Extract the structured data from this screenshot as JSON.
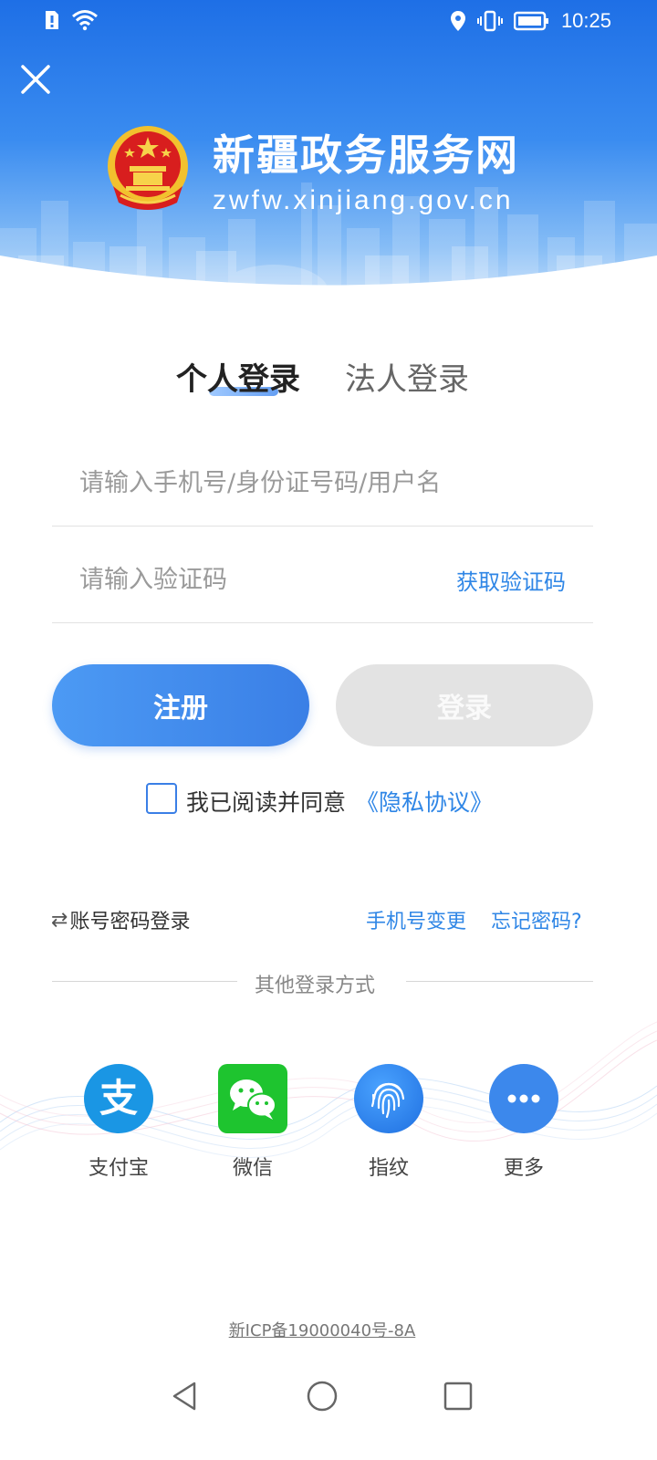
{
  "status_bar": {
    "time": "10:25",
    "icons": [
      "sim-alert-icon",
      "wifi-icon",
      "location-icon",
      "vibrate-icon",
      "battery-icon"
    ]
  },
  "header": {
    "site_title": "新疆政务服务网",
    "site_url": "zwfw.xinjiang.gov.cn",
    "close_icon": "close-icon",
    "emblem": "national-emblem"
  },
  "tabs": [
    {
      "label": "个人登录",
      "active": true
    },
    {
      "label": "法人登录",
      "active": false
    }
  ],
  "form": {
    "account_placeholder": "请输入手机号/身份证号码/用户名",
    "code_placeholder": "请输入验证码",
    "get_code_label": "获取验证码"
  },
  "buttons": {
    "register_label": "注册",
    "login_label": "登录"
  },
  "agreement": {
    "checked": false,
    "text": "我已阅读并同意",
    "link_text": "《隐私协议》"
  },
  "links": {
    "switch_icon": "⇄",
    "switch_login": "账号密码登录",
    "phone_change": "手机号变更",
    "forgot_password": "忘记密码?"
  },
  "other_login": {
    "title": "其他登录方式",
    "options": [
      {
        "label": "支付宝",
        "icon": "alipay-icon"
      },
      {
        "label": "微信",
        "icon": "wechat-icon"
      },
      {
        "label": "指纹",
        "icon": "fingerprint-icon"
      },
      {
        "label": "更多",
        "icon": "more-icon"
      }
    ]
  },
  "footer": {
    "icp": "新ICP备19000040号-8A"
  },
  "colors": {
    "primary": "#3a7fe6",
    "link": "#2f86e6",
    "disabled_button": "#e3e3e3",
    "header_top": "#1e6fe6"
  }
}
